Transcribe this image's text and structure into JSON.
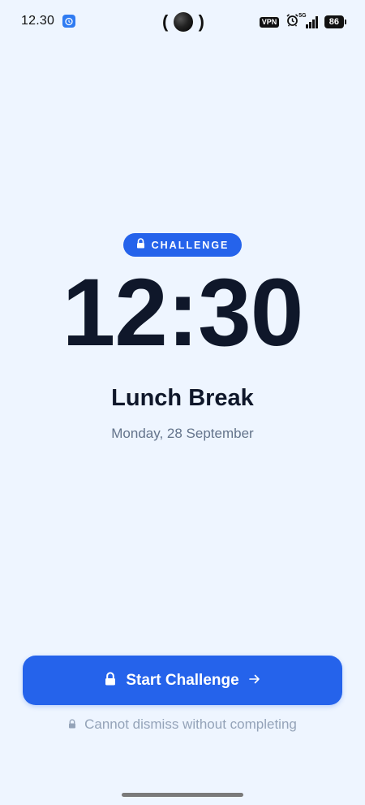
{
  "status_bar": {
    "time": "12.30",
    "vpn": "VPN",
    "network": "5G",
    "battery": "86"
  },
  "challenge_badge": {
    "label": "CHALLENGE",
    "icon": "lock-icon"
  },
  "alarm": {
    "time": "12:30",
    "title": "Lunch Break",
    "date": "Monday, 28 September"
  },
  "start_button": {
    "label": "Start Challenge",
    "icon_left": "lock-icon",
    "icon_right": "arrow-right-icon"
  },
  "dismiss_note": {
    "text": "Cannot dismiss without completing",
    "icon": "lock-icon"
  },
  "colors": {
    "background": "#eef5ff",
    "accent": "#2563eb",
    "text_primary": "#0f172a",
    "text_secondary": "#64748b",
    "text_muted": "#94a3b8"
  }
}
